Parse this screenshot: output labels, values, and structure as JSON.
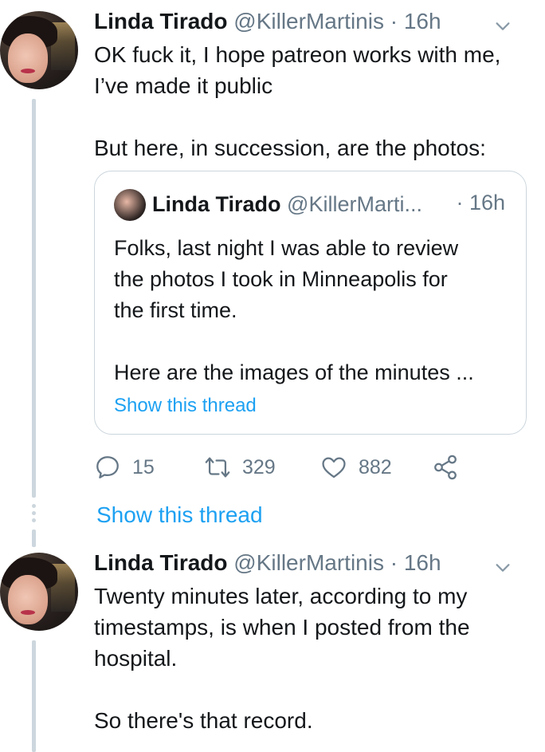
{
  "tweet1": {
    "name": "Linda Tirado",
    "handle": "@KillerMartinis",
    "separator": "·",
    "time": "16h",
    "text": "OK fuck it, I hope patreon works with me,\nI’ve made it public\n\nBut here, in succession, are the photos:"
  },
  "quote": {
    "name": "Linda Tirado",
    "handle": "@KillerMarti...",
    "time": "· 16h",
    "text": "Folks, last night I was able to review\nthe photos I took in Minneapolis for\nthe first time.\n\nHere are the images of the minutes ...",
    "link": "Show this thread"
  },
  "actions": {
    "replies": "15",
    "retweets": "329",
    "likes": "882"
  },
  "show_thread": "Show this thread",
  "tweet2": {
    "name": "Linda Tirado",
    "handle": "@KillerMartinis",
    "separator": "·",
    "time": "16h",
    "text": "Twenty minutes later, according to my\ntimestamps, is when I posted from the\nhospital.\n\nSo there's that record."
  },
  "icons": {
    "reply": "reply-icon",
    "retweet": "retweet-icon",
    "like": "heart-icon",
    "share": "share-icon",
    "caret": "chevron-down-icon"
  },
  "colors": {
    "link": "#1da1f2",
    "secondary": "#657786",
    "border": "#ccd6dd"
  }
}
